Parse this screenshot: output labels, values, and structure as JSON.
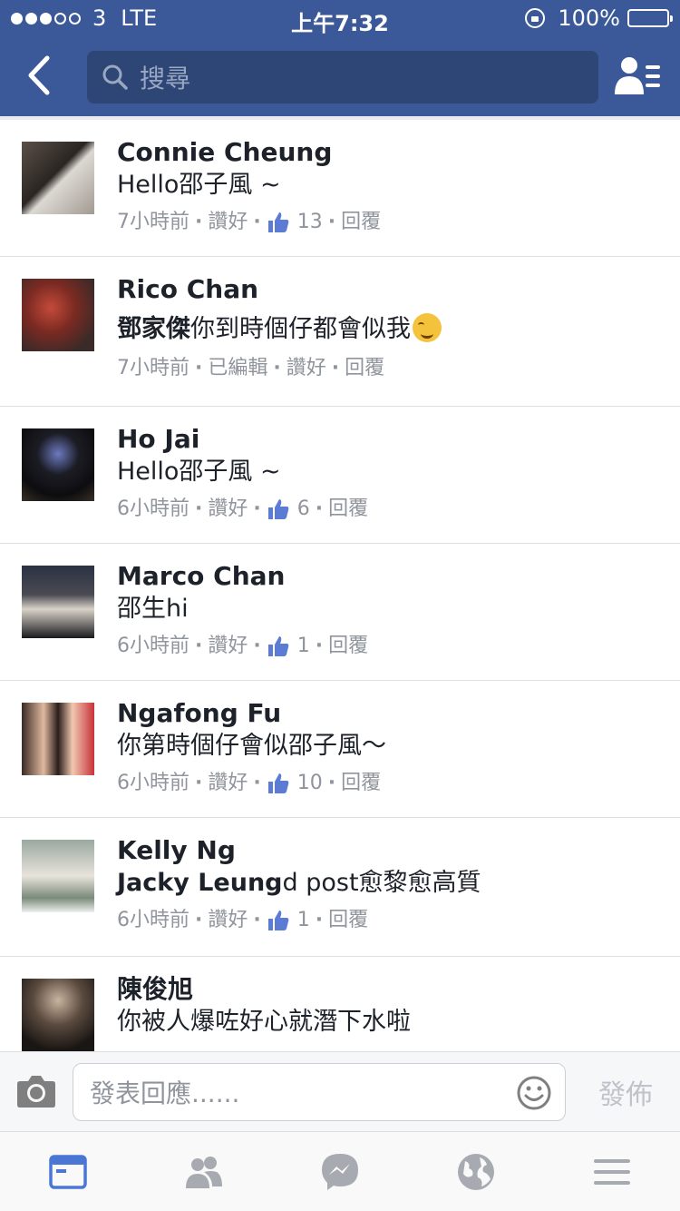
{
  "status_bar": {
    "carrier": "3",
    "network": "LTE",
    "time": "上午7:32",
    "battery": "100%"
  },
  "nav": {
    "search_placeholder": "搜尋"
  },
  "comments": [
    {
      "author": "Connie  Cheung",
      "text": "Hello邵子風 ~",
      "time": "7小時前",
      "like_label": "讚好",
      "like_count": "13",
      "reply_label": "回覆"
    },
    {
      "author": "Rico Chan",
      "mention": "鄧家傑",
      "text": "你到時個仔都會似我",
      "time": "7小時前",
      "edited_label": "已編輯",
      "like_label": "讚好",
      "reply_label": "回覆"
    },
    {
      "author": "Ho Jai",
      "text": "Hello邵子風 ~",
      "time": "6小時前",
      "like_label": "讚好",
      "like_count": "6",
      "reply_label": "回覆"
    },
    {
      "author": "Marco Chan",
      "text": "邵生hi",
      "time": "6小時前",
      "like_label": "讚好",
      "like_count": "1",
      "reply_label": "回覆"
    },
    {
      "author": "Ngafong Fu",
      "text": "你第時個仔會似邵子風～",
      "time": "6小時前",
      "like_label": "讚好",
      "like_count": "10",
      "reply_label": "回覆"
    },
    {
      "author": "Kelly Ng",
      "mention": "Jacky Leung",
      "text": "d post愈黎愈高質",
      "time": "6小時前",
      "like_label": "讚好",
      "like_count": "1",
      "reply_label": "回覆"
    },
    {
      "author": "陳俊旭",
      "text": "你被人爆咗好心就潛下水啦"
    }
  ],
  "composer": {
    "placeholder": "發表回應......",
    "post_label": "發佈"
  },
  "colors": {
    "brand": "#3b5998",
    "meta": "#90949c",
    "like_icon": "#5b7bd5"
  },
  "icons": {
    "status": [
      "signal-dots-icon",
      "rotation-lock-icon",
      "battery-icon"
    ],
    "nav": [
      "back-chevron-icon",
      "search-icon",
      "friend-requests-icon"
    ],
    "composer": [
      "camera-icon",
      "smiley-icon"
    ],
    "tabs": [
      "news-feed-icon",
      "friends-icon",
      "messenger-icon",
      "notifications-globe-icon",
      "menu-icon"
    ]
  }
}
